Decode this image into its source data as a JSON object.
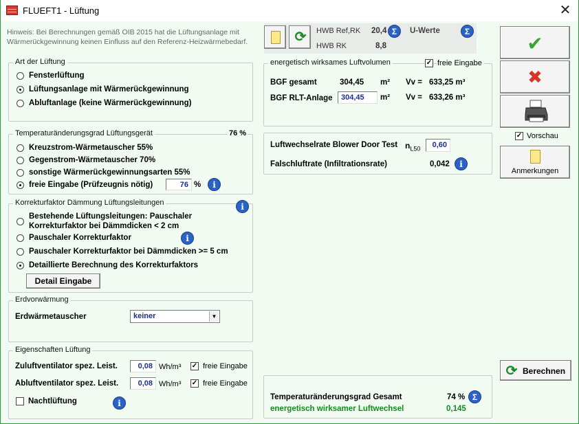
{
  "window": {
    "title": "FLUEFT1 - Lüftung",
    "close_glyph": "✕"
  },
  "hint": "Hinweis: Bei Berechnungen gemäß OIB 2015 hat die Lüftungsanlage mit Wärmerückgewinnung keinen Einfluss auf den Referenz-Heizwärmebedarf.",
  "toolbar": {
    "hwb_ref_rk_label": "HWB Ref,RK",
    "hwb_ref_rk_value": "20,4",
    "u_werte_label": "U-Werte",
    "hwb_rk_label": "HWB RK",
    "hwb_rk_value": "8,8",
    "sigma_glyph": "Σ"
  },
  "art": {
    "legend": "Art der Lüftung",
    "options": [
      "Fensterlüftung",
      "Lüftungsanlage mit Wärmerückgewinnung",
      "Abluftanlage (keine Wärmerückgewinnung)"
    ],
    "selected": 1
  },
  "temp": {
    "legend": "Temperaturänderungsgrad Lüftungsgerät",
    "value_display": "76 %",
    "options": [
      "Kreuzstrom-Wärmetauscher 55%",
      "Gegenstrom-Wärmetauscher 70%",
      "sonstige Wärmerückgewinnungsarten 55%",
      "freie Eingabe (Prüfzeugnis nötig)"
    ],
    "selected": 3,
    "free_value": "76",
    "unit": "%"
  },
  "korr": {
    "legend": "Korrekturfaktor Dämmung Lüftungsleitungen",
    "option1_line1": "Bestehende Lüftungsleitungen: Pauschaler",
    "option1_line2": "Korrekturfaktor bei Dämmdicken < 2 cm",
    "option2": "Pauschaler Korrekturfaktor",
    "option3": "Pauschaler Korrekturfaktor bei Dämmdicken >= 5 cm",
    "option4": "Detaillierte Berechnung des Korrekturfaktors",
    "selected": 3,
    "detail_button": "Detail Eingabe"
  },
  "erd": {
    "legend": "Erdvorwärmung",
    "label": "Erdwärmetauscher",
    "value": "keiner",
    "arrow": "▼"
  },
  "eig": {
    "legend": "Eigenschaften Lüftung",
    "zuluft_label": "Zuluftventilator spez. Leist.",
    "zuluft_value": "0,08",
    "abluft_label": "Abluftventilator spez. Leist.",
    "abluft_value": "0,08",
    "unit": "Wh/m³",
    "free_label": "freie Eingabe",
    "nacht_label": "Nachtlüftung"
  },
  "volumen": {
    "legend": "energetisch wirksames Luftvolumen",
    "free_label": "freie Eingabe",
    "bgf_label": "BGF gesamt",
    "bgf_value": "304,45",
    "bgf_rlt_label": "BGF RLT-Anlage",
    "bgf_rlt_value": "304,45",
    "unit_m2": "m²",
    "vv_label": "Vv =",
    "vv1": "633,25 m³",
    "vv2": "633,26 m³"
  },
  "blower": {
    "label": "Luftwechselrate Blower Door Test",
    "n_label": "n",
    "n_sub": "L50",
    "value": "0,60",
    "falsch_label": "Falschluftrate (Infiltrationsrate)",
    "falsch_value": "0,042"
  },
  "result": {
    "temp_label": "Temperaturänderungsgrad Gesamt",
    "temp_value": "74 %",
    "luft_label": "energetisch wirksamer Luftwechsel",
    "luft_value": "0,145"
  },
  "buttons": {
    "ok_glyph": "✔",
    "cancel_glyph": "✖",
    "vorschau_label": "Vorschau",
    "anmerkungen_label": "Anmerkungen",
    "berechnen_label": "Berechnen",
    "refresh_glyph": "⟳",
    "info_glyph": "i"
  },
  "colors": {
    "accent_green": "#2f9a3c",
    "value_blue": "#1b2f8c",
    "info_blue": "#2a63c5",
    "result_green": "#138c1e"
  }
}
